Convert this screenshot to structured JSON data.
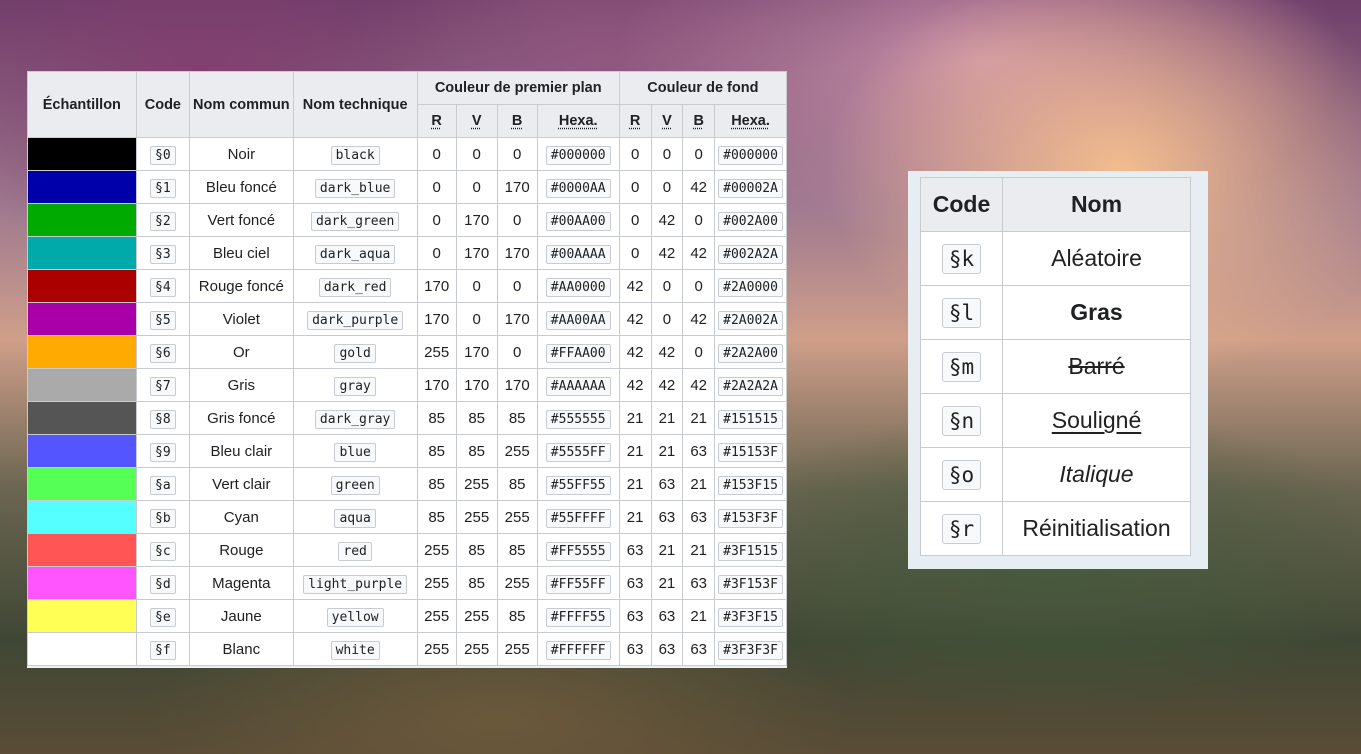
{
  "color_table": {
    "headers": {
      "sample": "Échantillon",
      "code": "Code",
      "common_name": "Nom commun",
      "technical_name": "Nom technique",
      "foreground": "Couleur de premier plan",
      "background": "Couleur de fond",
      "r": "R",
      "v": "V",
      "b": "B",
      "hex": "Hexa."
    },
    "rows": [
      {
        "swatch": "#000000",
        "code": "§0",
        "name": "Noir",
        "tech": "black",
        "fg_r": "0",
        "fg_v": "0",
        "fg_b": "0",
        "fg_hex": "#000000",
        "bg_r": "0",
        "bg_v": "0",
        "bg_b": "0",
        "bg_hex": "#000000"
      },
      {
        "swatch": "#0000AA",
        "code": "§1",
        "name": "Bleu foncé",
        "tech": "dark_blue",
        "fg_r": "0",
        "fg_v": "0",
        "fg_b": "170",
        "fg_hex": "#0000AA",
        "bg_r": "0",
        "bg_v": "0",
        "bg_b": "42",
        "bg_hex": "#00002A"
      },
      {
        "swatch": "#00AA00",
        "code": "§2",
        "name": "Vert foncé",
        "tech": "dark_green",
        "fg_r": "0",
        "fg_v": "170",
        "fg_b": "0",
        "fg_hex": "#00AA00",
        "bg_r": "0",
        "bg_v": "42",
        "bg_b": "0",
        "bg_hex": "#002A00"
      },
      {
        "swatch": "#00AAAA",
        "code": "§3",
        "name": "Bleu ciel",
        "tech": "dark_aqua",
        "fg_r": "0",
        "fg_v": "170",
        "fg_b": "170",
        "fg_hex": "#00AAAA",
        "bg_r": "0",
        "bg_v": "42",
        "bg_b": "42",
        "bg_hex": "#002A2A"
      },
      {
        "swatch": "#AA0000",
        "code": "§4",
        "name": "Rouge foncé",
        "tech": "dark_red",
        "fg_r": "170",
        "fg_v": "0",
        "fg_b": "0",
        "fg_hex": "#AA0000",
        "bg_r": "42",
        "bg_v": "0",
        "bg_b": "0",
        "bg_hex": "#2A0000"
      },
      {
        "swatch": "#AA00AA",
        "code": "§5",
        "name": "Violet",
        "tech": "dark_purple",
        "fg_r": "170",
        "fg_v": "0",
        "fg_b": "170",
        "fg_hex": "#AA00AA",
        "bg_r": "42",
        "bg_v": "0",
        "bg_b": "42",
        "bg_hex": "#2A002A"
      },
      {
        "swatch": "#FFAA00",
        "code": "§6",
        "name": "Or",
        "tech": "gold",
        "fg_r": "255",
        "fg_v": "170",
        "fg_b": "0",
        "fg_hex": "#FFAA00",
        "bg_r": "42",
        "bg_v": "42",
        "bg_b": "0",
        "bg_hex": "#2A2A00"
      },
      {
        "swatch": "#AAAAAA",
        "code": "§7",
        "name": "Gris",
        "tech": "gray",
        "fg_r": "170",
        "fg_v": "170",
        "fg_b": "170",
        "fg_hex": "#AAAAAA",
        "bg_r": "42",
        "bg_v": "42",
        "bg_b": "42",
        "bg_hex": "#2A2A2A"
      },
      {
        "swatch": "#555555",
        "code": "§8",
        "name": "Gris foncé",
        "tech": "dark_gray",
        "fg_r": "85",
        "fg_v": "85",
        "fg_b": "85",
        "fg_hex": "#555555",
        "bg_r": "21",
        "bg_v": "21",
        "bg_b": "21",
        "bg_hex": "#151515"
      },
      {
        "swatch": "#5555FF",
        "code": "§9",
        "name": "Bleu clair",
        "tech": "blue",
        "fg_r": "85",
        "fg_v": "85",
        "fg_b": "255",
        "fg_hex": "#5555FF",
        "bg_r": "21",
        "bg_v": "21",
        "bg_b": "63",
        "bg_hex": "#15153F"
      },
      {
        "swatch": "#55FF55",
        "code": "§a",
        "name": "Vert clair",
        "tech": "green",
        "fg_r": "85",
        "fg_v": "255",
        "fg_b": "85",
        "fg_hex": "#55FF55",
        "bg_r": "21",
        "bg_v": "63",
        "bg_b": "21",
        "bg_hex": "#153F15"
      },
      {
        "swatch": "#55FFFF",
        "code": "§b",
        "name": "Cyan",
        "tech": "aqua",
        "fg_r": "85",
        "fg_v": "255",
        "fg_b": "255",
        "fg_hex": "#55FFFF",
        "bg_r": "21",
        "bg_v": "63",
        "bg_b": "63",
        "bg_hex": "#153F3F"
      },
      {
        "swatch": "#FF5555",
        "code": "§c",
        "name": "Rouge",
        "tech": "red",
        "fg_r": "255",
        "fg_v": "85",
        "fg_b": "85",
        "fg_hex": "#FF5555",
        "bg_r": "63",
        "bg_v": "21",
        "bg_b": "21",
        "bg_hex": "#3F1515"
      },
      {
        "swatch": "#FF55FF",
        "code": "§d",
        "name": "Magenta",
        "tech": "light_purple",
        "fg_r": "255",
        "fg_v": "85",
        "fg_b": "255",
        "fg_hex": "#FF55FF",
        "bg_r": "63",
        "bg_v": "21",
        "bg_b": "63",
        "bg_hex": "#3F153F"
      },
      {
        "swatch": "#FFFF55",
        "code": "§e",
        "name": "Jaune",
        "tech": "yellow",
        "fg_r": "255",
        "fg_v": "255",
        "fg_b": "85",
        "fg_hex": "#FFFF55",
        "bg_r": "63",
        "bg_v": "63",
        "bg_b": "21",
        "bg_hex": "#3F3F15"
      },
      {
        "swatch": "#FFFFFF",
        "code": "§f",
        "name": "Blanc",
        "tech": "white",
        "fg_r": "255",
        "fg_v": "255",
        "fg_b": "255",
        "fg_hex": "#FFFFFF",
        "bg_r": "63",
        "bg_v": "63",
        "bg_b": "63",
        "bg_hex": "#3F3F3F"
      }
    ]
  },
  "format_table": {
    "headers": {
      "code": "Code",
      "name": "Nom"
    },
    "rows": [
      {
        "code": "§k",
        "name": "Aléatoire",
        "style": "obfuscated"
      },
      {
        "code": "§l",
        "name": "Gras",
        "style": "bold"
      },
      {
        "code": "§m",
        "name": "Barré",
        "style": "strikethrough"
      },
      {
        "code": "§n",
        "name": "Souligné",
        "style": "underline"
      },
      {
        "code": "§o",
        "name": "Italique",
        "style": "italic"
      },
      {
        "code": "§r",
        "name": "Réinitialisation",
        "style": "reset"
      }
    ]
  }
}
